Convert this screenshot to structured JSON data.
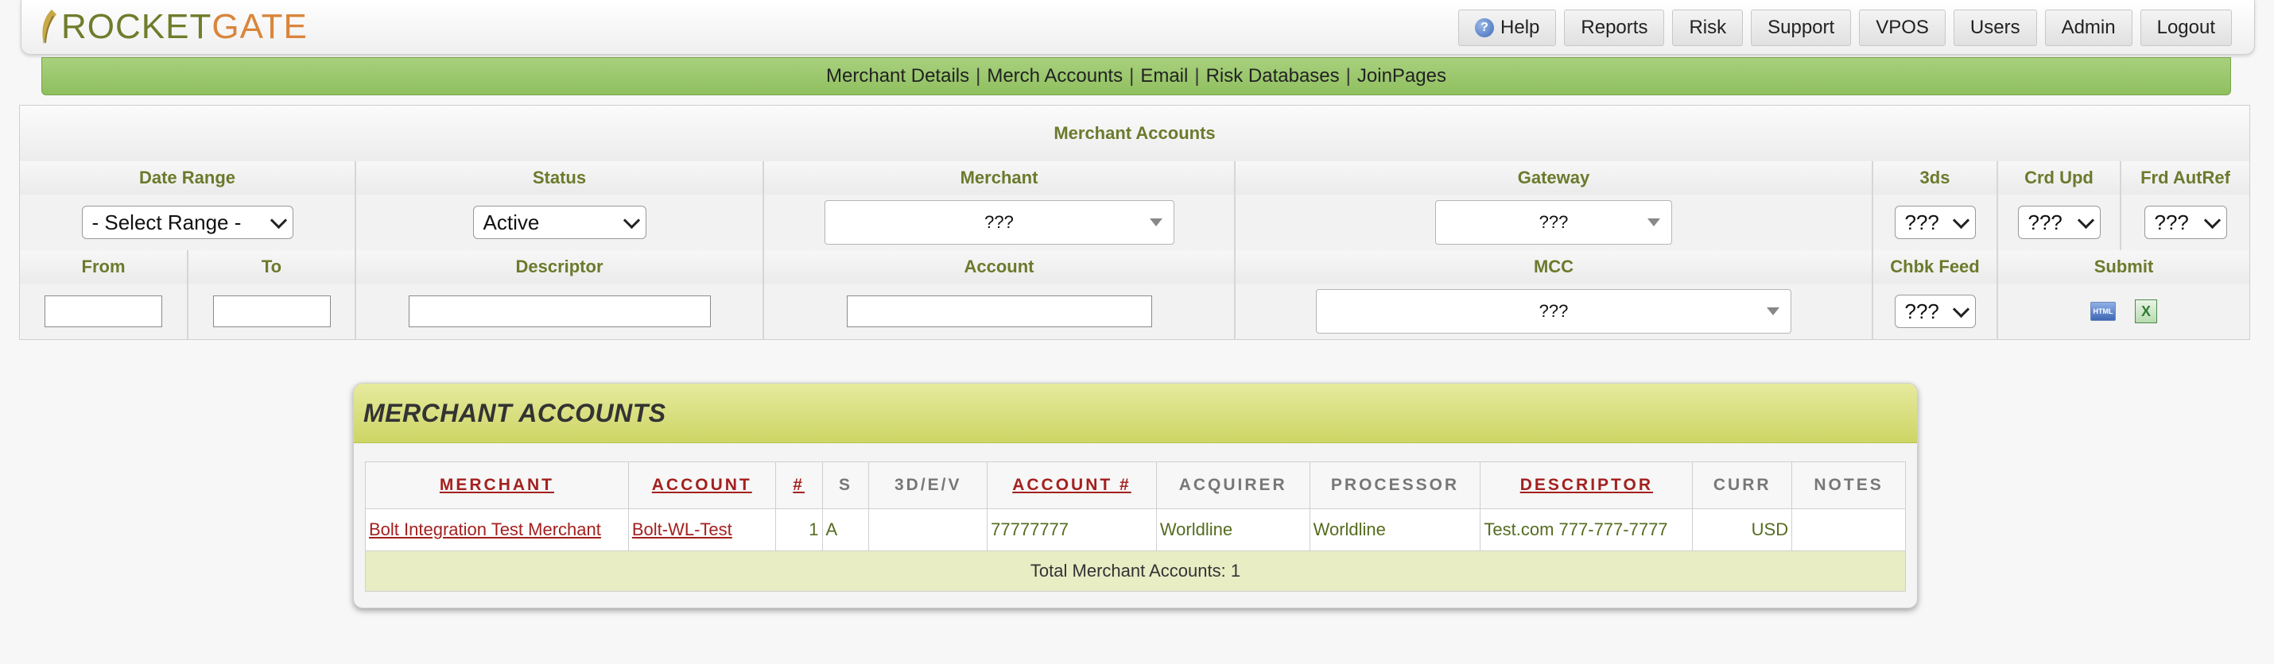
{
  "logo": {
    "rocket": "ROCKET",
    "gate": "GATE"
  },
  "nav": {
    "buttons": [
      "Help",
      "Reports",
      "Risk",
      "Support",
      "VPOS",
      "Users",
      "Admin",
      "Logout"
    ]
  },
  "subnav": {
    "items": [
      "Merchant Details",
      "Merch Accounts",
      "Email",
      "Risk Databases",
      "JoinPages"
    ],
    "separator": "|"
  },
  "filter": {
    "title": "Merchant Accounts",
    "headers1": {
      "date_range": "Date Range",
      "status": "Status",
      "merchant": "Merchant",
      "gateway": "Gateway",
      "threeds": "3ds",
      "crd_upd": "Crd Upd",
      "frd_autref": "Frd AutRef"
    },
    "controls1": {
      "date_range": "- Select Range -",
      "status": "Active",
      "merchant": "???",
      "gateway": "???",
      "threeds": "???",
      "crd_upd": "???",
      "frd_autref": "???"
    },
    "headers2": {
      "from": "From",
      "to": "To",
      "descriptor": "Descriptor",
      "account": "Account",
      "mcc": "MCC",
      "chbk_feed": "Chbk Feed",
      "submit": "Submit"
    },
    "controls2": {
      "mcc": "???",
      "chbk_feed": "???",
      "html_icon": "HTML",
      "xls_icon": "X"
    }
  },
  "merchant_accounts": {
    "title": "MERCHANT ACCOUNTS",
    "columns": [
      "MERCHANT",
      "ACCOUNT",
      "#",
      "S",
      "3D/E/V",
      "ACCOUNT #",
      "ACQUIRER",
      "PROCESSOR",
      "DESCRIPTOR",
      "CURR",
      "NOTES"
    ],
    "rows": [
      {
        "merchant": "Bolt Integration Test Merchant",
        "account": "Bolt-WL-Test",
        "num": "1",
        "s": "A",
        "tdev": "",
        "account_num": "77777777",
        "acquirer": "Worldline",
        "processor": "Worldline",
        "descriptor": "Test.com 777-777-7777",
        "curr": "USD",
        "notes": ""
      }
    ],
    "total": "Total Merchant Accounts: 1"
  }
}
